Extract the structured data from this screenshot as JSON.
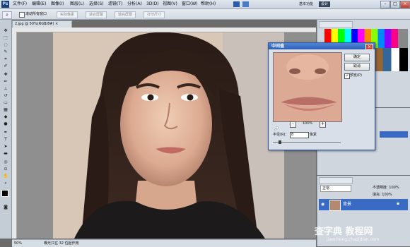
{
  "menubar": {
    "logo": "Ps",
    "items": [
      "文件(F)",
      "编辑(E)",
      "图像(I)",
      "图层(L)",
      "选择(S)",
      "滤镜(T)",
      "分析(A)",
      "3D(D)",
      "视图(V)",
      "窗口(W)",
      "帮助(H)"
    ],
    "workspaces": [
      "基本功能",
      "设计"
    ],
    "active_workspace": "设计"
  },
  "options": {
    "checkbox_label": "滚动所有窗口",
    "buttons": [
      "实际像素",
      "适合屏幕",
      "填充屏幕",
      "打印尺寸"
    ]
  },
  "document": {
    "tab_title": "2.jpg @ 50%(RGB/8#)",
    "zoom": "50%",
    "status": "曝光只在 32 位起作用"
  },
  "dialog": {
    "title": "中间值",
    "ok_label": "确定",
    "cancel_label": "取消",
    "preview_label": "预览(P)",
    "zoom_value": "100%",
    "radius_label": "半径(R):",
    "radius_value": "8",
    "radius_unit": "像素"
  },
  "panels": {
    "layers_mode": "正常",
    "opacity_label": "不透明度: 100%",
    "fill_label": "填充: 100%",
    "layer_name": "背景"
  },
  "watermark": {
    "main": "查字典 教程网",
    "url": "jiaocheng.chazidian.com"
  },
  "colors": {
    "title_blue": "#2e5fb5",
    "selected_layer": "#3a6bc4"
  }
}
